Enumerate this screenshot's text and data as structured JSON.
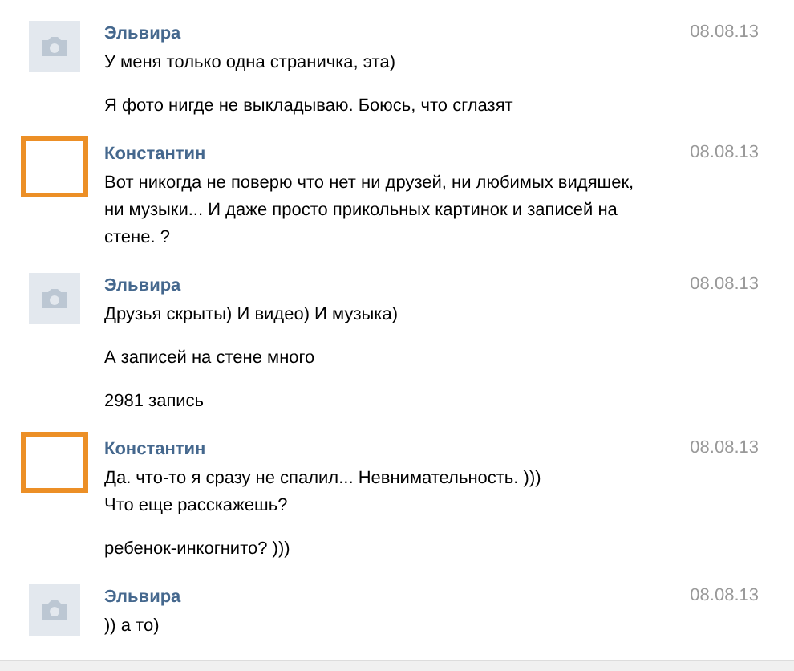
{
  "messages": [
    {
      "author": "Эльвира",
      "date": "08.08.13",
      "kind": "camera",
      "paragraphs": [
        [
          "У меня только одна страничка, эта)"
        ],
        [
          "Я фото нигде не выкладываю. Боюсь, что сглазят"
        ]
      ]
    },
    {
      "author": "Константин",
      "date": "08.08.13",
      "kind": "frame",
      "paragraphs": [
        [
          "Вот никогда не поверю что нет ни друзей, ни любимых видяшек,",
          "ни музыки... И даже просто прикольных картинок и записей на",
          "стене. ?"
        ]
      ]
    },
    {
      "author": "Эльвира",
      "date": "08.08.13",
      "kind": "camera",
      "paragraphs": [
        [
          "Друзья скрыты) И видео) И музыка)"
        ],
        [
          "А записей на стене много"
        ],
        [
          "2981 запись"
        ]
      ]
    },
    {
      "author": "Константин",
      "date": "08.08.13",
      "kind": "frame",
      "paragraphs": [
        [
          "Да. что-то я сразу не спалил... Невнимательность. )))",
          "Что еще расскажешь?"
        ],
        [
          "ребенок-инкогнито? )))"
        ]
      ]
    },
    {
      "author": "Эльвира",
      "date": "08.08.13",
      "kind": "camera",
      "paragraphs": [
        [
          ")) а то)"
        ]
      ]
    }
  ]
}
